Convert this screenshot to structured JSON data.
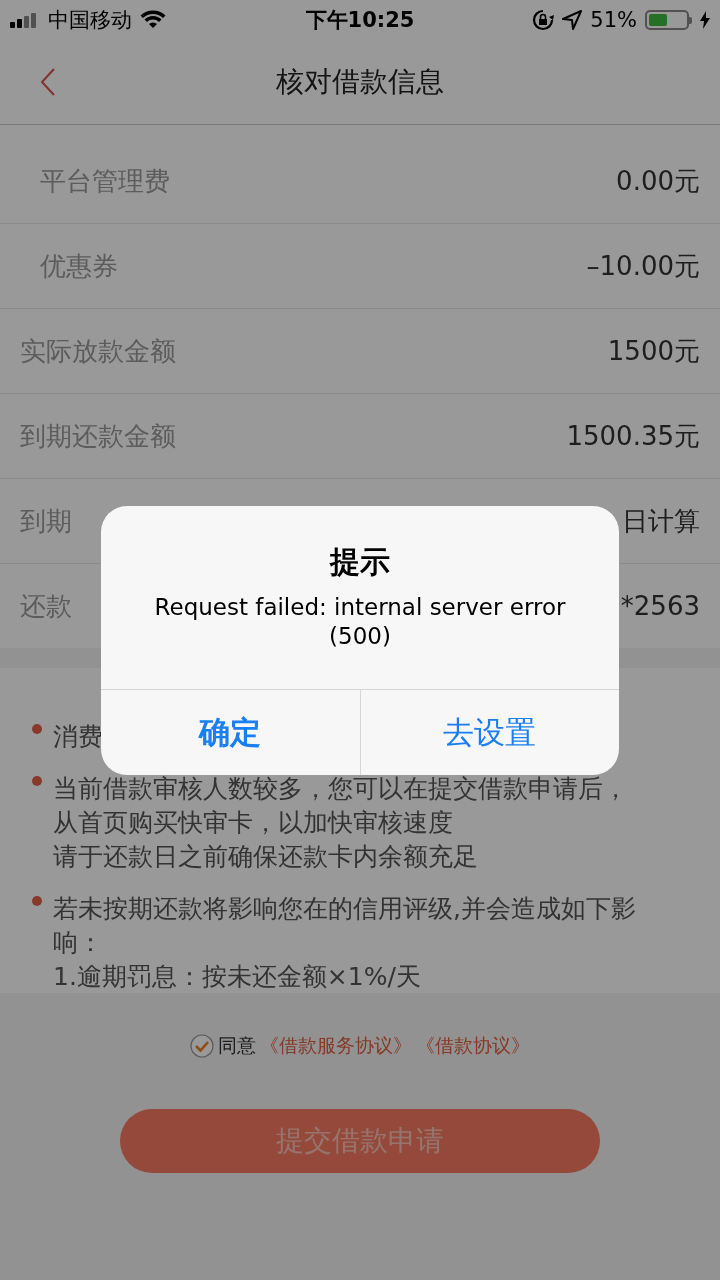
{
  "status_bar": {
    "carrier": "中国移动",
    "time": "下午10:25",
    "battery_text": "51%",
    "battery": {
      "level": 0.51,
      "charging": true
    }
  },
  "nav": {
    "title": "核对借款信息"
  },
  "rows": [
    {
      "label": "平台管理费",
      "value": "0.00元",
      "indented": true
    },
    {
      "label": "优惠券",
      "value": "–10.00元",
      "indented": true
    },
    {
      "label": "实际放款金额",
      "value": "1500元",
      "indented": false
    },
    {
      "label": "到期还款金额",
      "value": "1500.35元",
      "indented": false
    },
    {
      "label": "到期",
      "value": "日计算",
      "indented": false
    },
    {
      "label": "还款",
      "value": "*2563",
      "indented": false
    }
  ],
  "notes": [
    {
      "bullet": true,
      "lines": [
        "消费"
      ]
    },
    {
      "bullet": true,
      "lines": [
        "当前借款审核人数较多，您可以在提交借款申请后，",
        "从首页购买快审卡，以加快审核速度"
      ]
    },
    {
      "bullet": false,
      "lines": [
        "请于还款日之前确保还款卡内余额充足"
      ]
    },
    {
      "bullet": true,
      "lines": [
        "若未按期还款将影响您在的信用评级,并会造成如下影",
        "响："
      ]
    },
    {
      "bullet": false,
      "lines": [
        "1.逾期罚息：按未还金额×1%/天"
      ]
    }
  ],
  "agreement": {
    "checked": true,
    "label": "同意",
    "links": [
      "《借款服务协议》",
      "《借款协议》"
    ]
  },
  "submit": {
    "label": "提交借款申请"
  },
  "alert": {
    "title": "提示",
    "message_lines": [
      "Request failed: internal server error",
      "(500)"
    ],
    "buttons": [
      {
        "label": "确定",
        "kind": "bold"
      },
      {
        "label": "去设置",
        "kind": "normal"
      }
    ]
  }
}
